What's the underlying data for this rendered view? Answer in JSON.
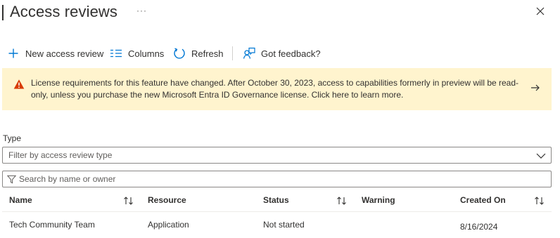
{
  "header": {
    "title": "Access reviews",
    "more_label": "···"
  },
  "toolbar": {
    "new_label": "New access review",
    "columns_label": "Columns",
    "refresh_label": "Refresh",
    "feedback_label": "Got feedback?"
  },
  "banner": {
    "text": "License requirements for this feature have changed. After October 30, 2023, access to capabilities formerly in preview will be read-only, unless you purchase the new Microsoft Entra ID Governance license. Click here to learn more."
  },
  "filter": {
    "type_label": "Type",
    "type_placeholder": "Filter by access review type"
  },
  "search": {
    "placeholder": "Search by name or owner"
  },
  "grid": {
    "columns": [
      "Name",
      "Resource",
      "Status",
      "Warning",
      "Created On"
    ],
    "rows": [
      {
        "name": "Tech Community Team",
        "resource": "Application",
        "status": "Not started",
        "warning": "",
        "created_on": "8/16/2024"
      }
    ]
  },
  "colors": {
    "accent": "#0078d4",
    "warning_banner_bg": "#fff4ce",
    "warning_icon": "#d83b01",
    "text": "#323130"
  }
}
